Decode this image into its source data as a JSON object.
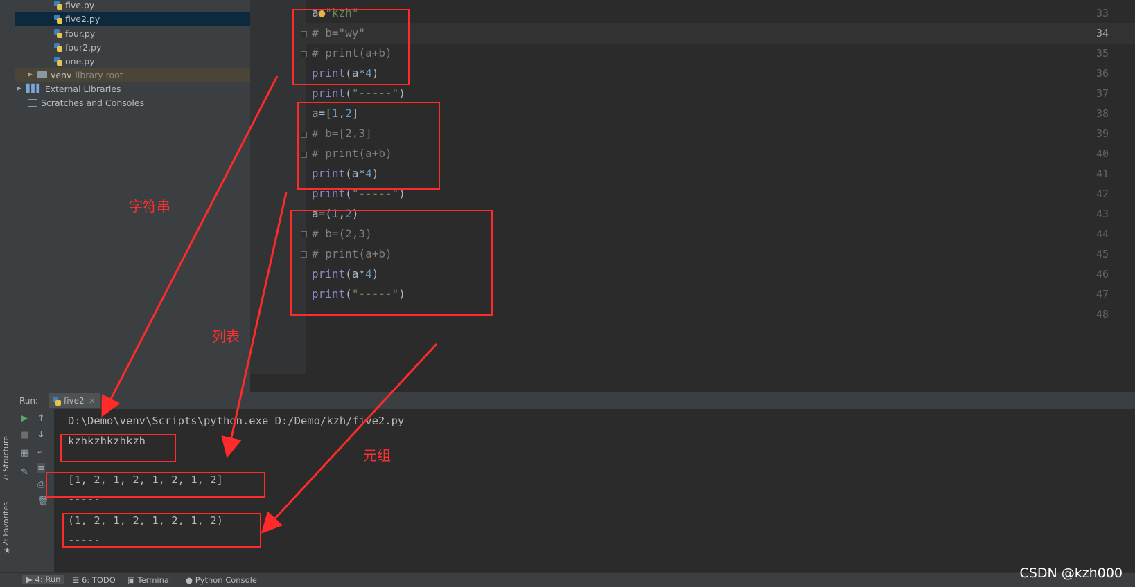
{
  "project_tree": {
    "files": [
      "five.py",
      "five2.py",
      "four.py",
      "four2.py",
      "one.py"
    ],
    "selected": "five2.py",
    "venv": {
      "name": "venv",
      "suffix": "library root"
    },
    "external_libraries": "External Libraries",
    "scratches": "Scratches and Consoles"
  },
  "editor": {
    "line_numbers": [
      "33",
      "34",
      "35",
      "36",
      "37",
      "38",
      "39",
      "40",
      "41",
      "42",
      "43",
      "44",
      "45",
      "46",
      "47",
      "48"
    ],
    "current_line": "34"
  },
  "side_tabs": {
    "structure": "7: Structure",
    "favorites": "2: Favorites"
  },
  "run_panel": {
    "label": "Run:",
    "tab_name": "five2",
    "command": "D:\\Demo\\venv\\Scripts\\python.exe D:/Demo/kzh/five2.py",
    "outputs": [
      "kzhkzhkzhkzh",
      "-----",
      "[1, 2, 1, 2, 1, 2, 1, 2]",
      "-----",
      "(1, 2, 1, 2, 1, 2, 1, 2)",
      "-----"
    ]
  },
  "bottom_tabs": [
    "4: Run",
    "6: TODO",
    "Terminal",
    "Python Console"
  ],
  "annotations": {
    "string": "字符串",
    "list": "列表",
    "tuple": "元组"
  },
  "watermark": "CSDN @kzh000",
  "colors": {
    "annotation_red": "#ff2a2a",
    "keyword": "#8888c6",
    "string": "#6a8759",
    "number": "#6897bb",
    "comment": "#808080"
  }
}
